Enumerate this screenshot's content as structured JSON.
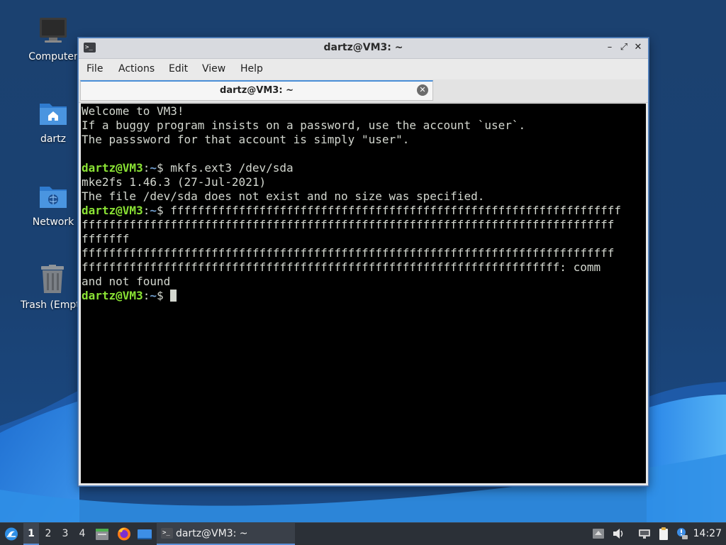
{
  "desktop": {
    "icons": [
      {
        "label": "Computer"
      },
      {
        "label": "dartz"
      },
      {
        "label": "Network"
      },
      {
        "label": "Trash (Empty)"
      }
    ]
  },
  "window": {
    "title": "dartz@VM3: ~",
    "title_icon": ">_",
    "controls": {
      "minimize": "–",
      "maximize": "⤢",
      "close": "✕"
    }
  },
  "menu": {
    "file": "File",
    "actions": "Actions",
    "edit": "Edit",
    "view": "View",
    "help": "Help"
  },
  "tab": {
    "label": "dartz@VM3: ~",
    "close_icon": "✕"
  },
  "terminal": {
    "prompt_user": "dartz@VM3",
    "prompt_sep": ":",
    "prompt_path": "~",
    "prompt_sym": "$ ",
    "welcome": [
      "Welcome to VM3!",
      "If a buggy program insists on a password, use the account `user`.",
      "The passsword for that account is simply \"user\"."
    ],
    "cmd1": "mkfs.ext3 /dev/sda",
    "out1": [
      "mke2fs 1.46.3 (27-Jul-2021)",
      "The file /dev/sda does not exist and no size was specified."
    ],
    "cmd2_line1": "ffffffffffffffffffffffffffffffffffffffffffffffffffffffffffffffffff",
    "cmd2_cont": [
      "ffffffffffffffffffffffffffffffffffffffffffffffffffffffffffffffffffffffffffffff",
      "fffffff",
      "ffffffffffffffffffffffffffffffffffffffffffffffffffffffffffffffffffffffffffffff",
      "ffffffffffffffffffffffffffffffffffffffffffffffffffffffffffffffffffffff: comm",
      "and not found"
    ]
  },
  "taskbar": {
    "workspaces": [
      "1",
      "2",
      "3",
      "4"
    ],
    "active_workspace": "1",
    "task_label": "dartz@VM3: ~",
    "task_icon": ">_",
    "clock": "14:27"
  },
  "colors": {
    "prompt_user": "#8ae234",
    "prompt_path": "#729fcf",
    "terminal_fg": "#d3d7cf",
    "terminal_bg": "#000000",
    "accent": "#4a8fd8"
  }
}
